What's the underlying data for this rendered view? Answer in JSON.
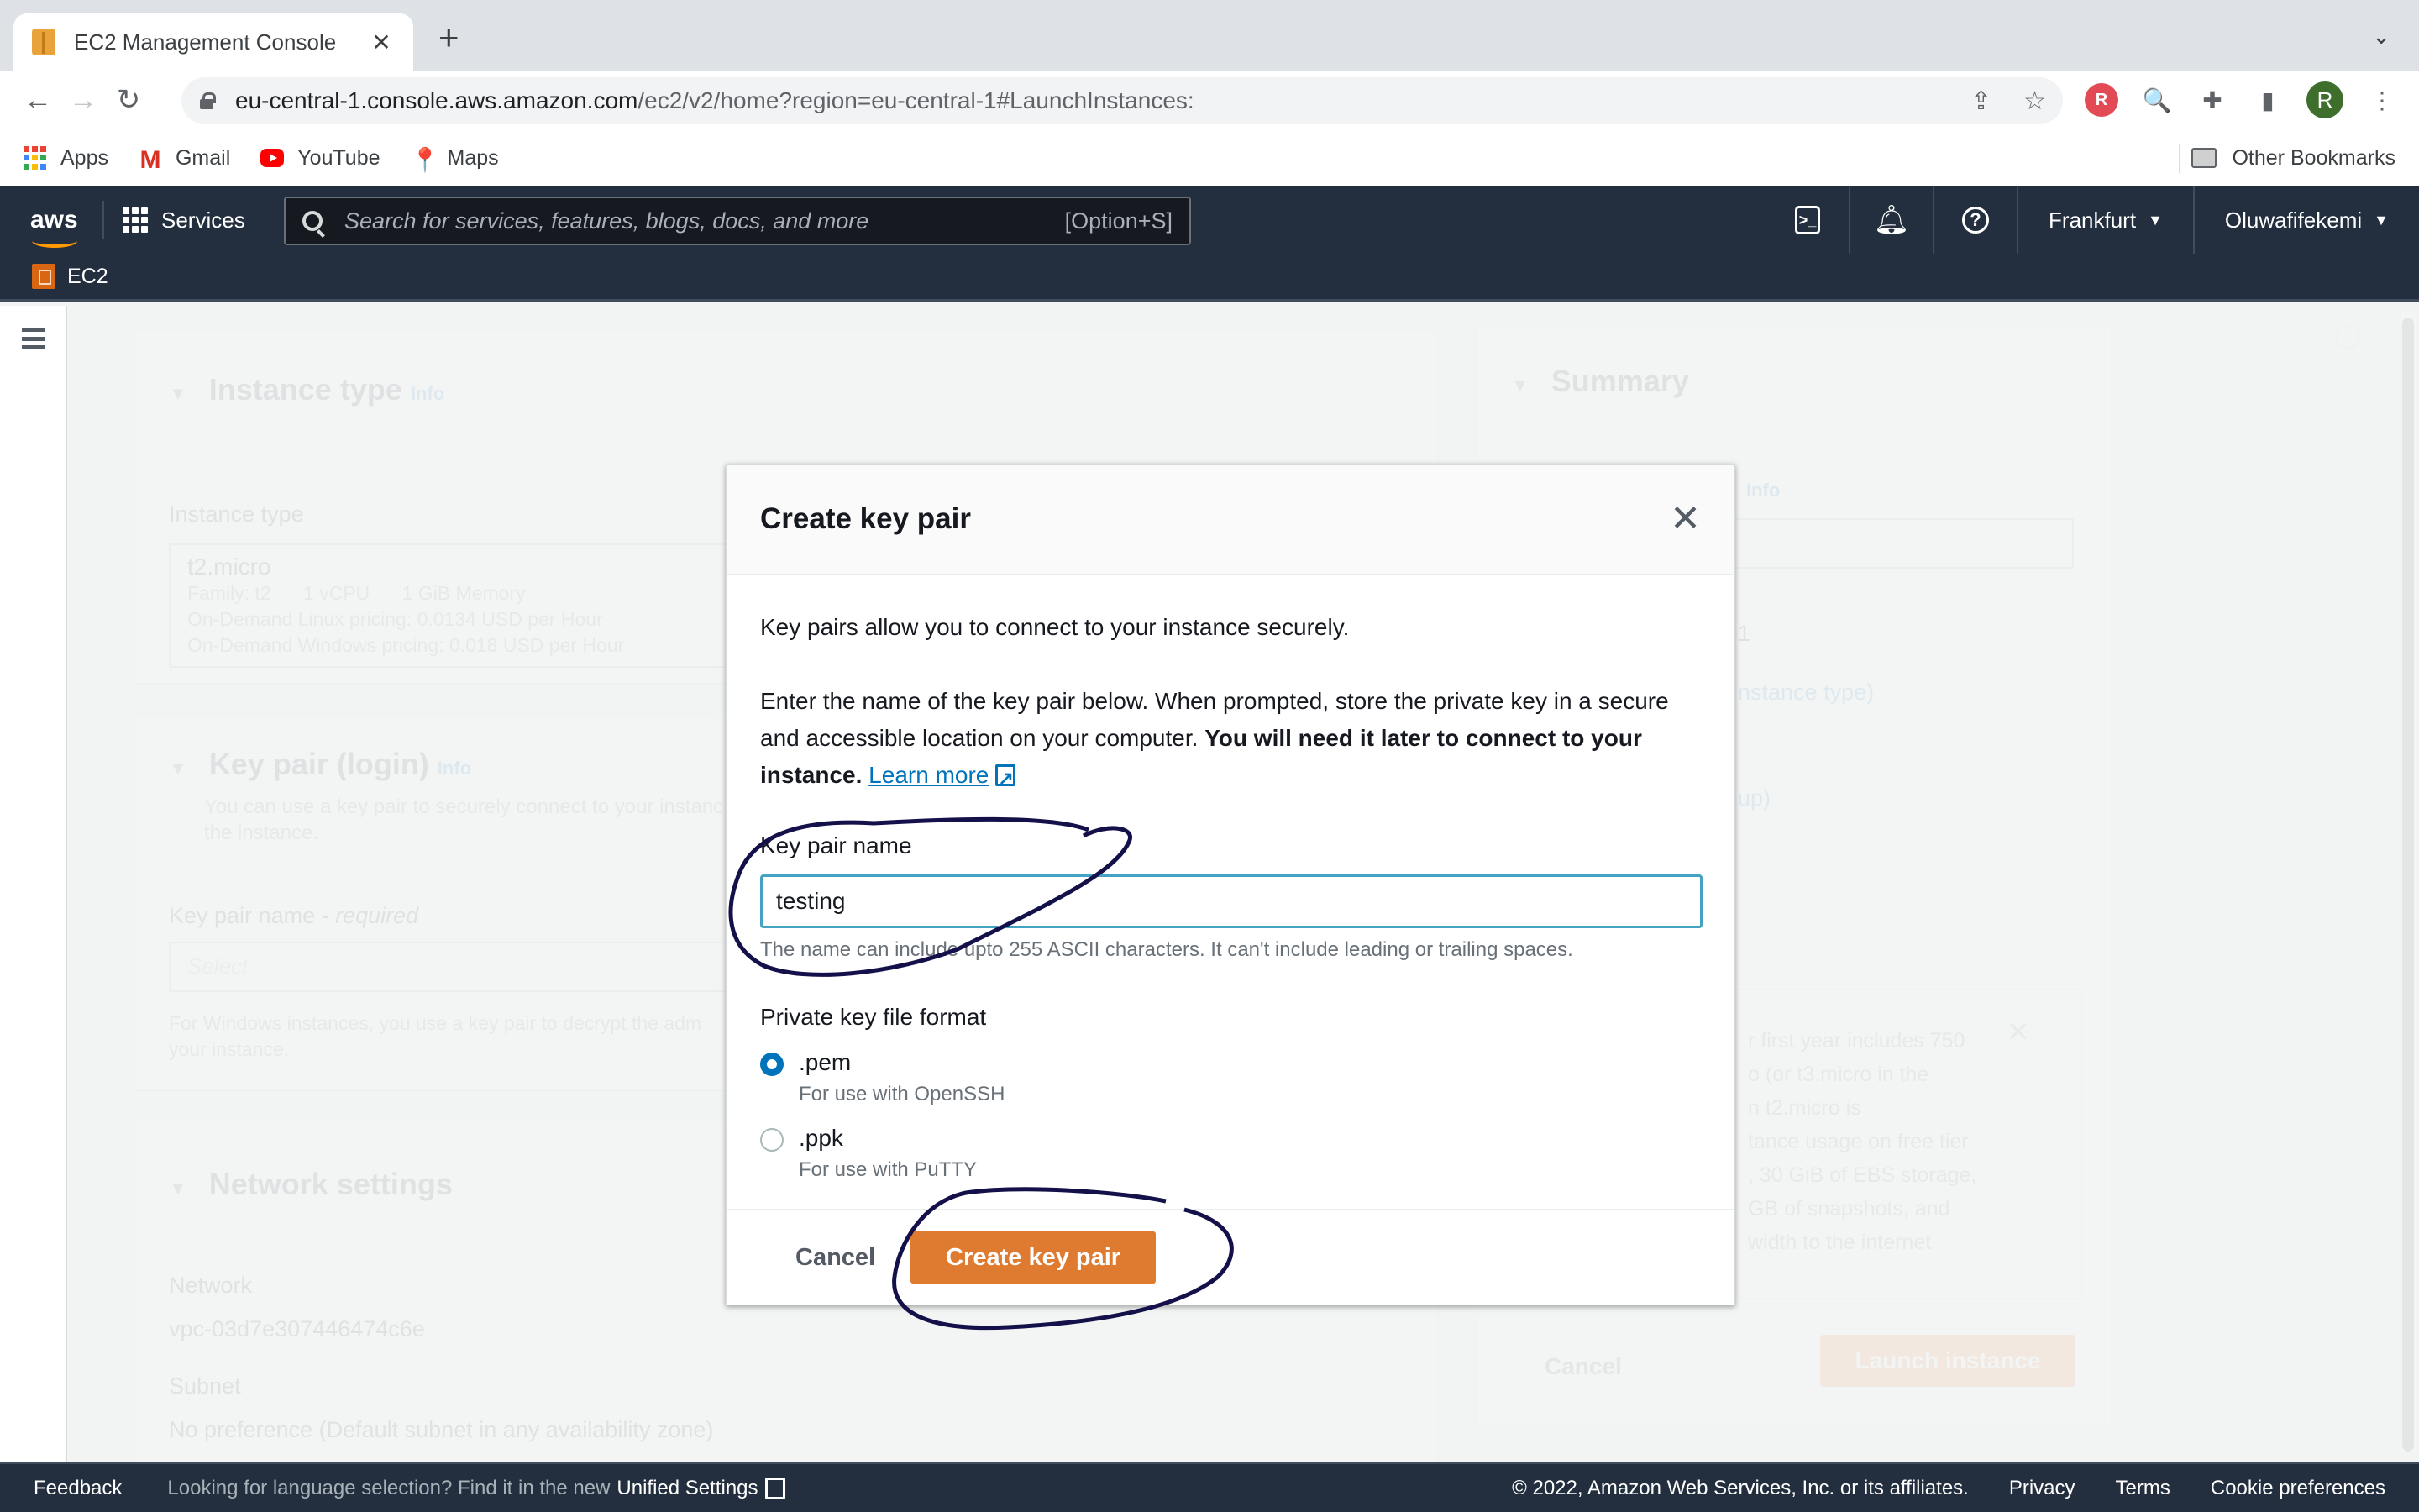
{
  "browser": {
    "tab_title": "EC2 Management Console",
    "tab_close": "✕",
    "new_tab": "+",
    "tab_search": "⌄",
    "url_host": "eu-central-1.console.aws.amazon.com",
    "url_path": "/ec2/v2/home?region=eu-central-1#LaunchInstances:",
    "profile_initial": "R",
    "bookmarks": [
      {
        "label": "Apps",
        "icon": "apps-grid-icon"
      },
      {
        "label": "Gmail",
        "icon": "gmail-icon"
      },
      {
        "label": "YouTube",
        "icon": "youtube-icon"
      },
      {
        "label": "Maps",
        "icon": "maps-pin-icon"
      }
    ],
    "other_bookmarks": "Other Bookmarks",
    "extension_r_label": "R"
  },
  "aws_header": {
    "logo": "aws",
    "services": "Services",
    "search_placeholder": "Search for services, features, blogs, docs, and more",
    "search_shortcut": "[Option+S]",
    "cloudshell_glyph": ">_",
    "help_glyph": "?",
    "region": "Frankfurt",
    "user": "Oluwafifekemi",
    "caret": "▼",
    "service_name": "EC2"
  },
  "background": {
    "instance_type_section": {
      "title": "Instance type",
      "info": "Info",
      "field_label": "Instance type",
      "value": "t2.micro",
      "details": [
        "Family: t2",
        "1 vCPU",
        "1 GiB Memory"
      ],
      "linux_pricing": "On-Demand Linux pricing: 0.0134 USD per Hour",
      "windows_pricing": "On-Demand Windows pricing: 0.018 USD per Hour"
    },
    "key_pair_section": {
      "title": "Key pair (login)",
      "info": "Info",
      "desc_line1": "You can use a key pair to securely connect to your instanc",
      "desc_line2": "the instance.",
      "field_label": "Key pair name - ",
      "field_required": "required",
      "select_placeholder": "Select",
      "help_line1": "For Windows instances, you use a key pair to decrypt the adm",
      "help_line2": "your instance."
    },
    "network_section": {
      "title": "Network settings",
      "network_label": "Network",
      "network_value": "vpc-03d7e307446474c6e",
      "subnet_label": "Subnet",
      "subnet_value": "No preference (Default subnet in any availability zone)"
    },
    "summary": {
      "title": "Summary",
      "info": "Info",
      "frag_1": "1",
      "frag_instance_type": "nstance type)",
      "frag_group": "up)",
      "free_tier_lines": [
        "r first year includes 750",
        "o (or t3.micro in the",
        "n t2.micro is",
        "tance usage on free tier",
        ", 30 GiB of EBS storage,",
        "GB of snapshots, and",
        "width to the internet"
      ],
      "cancel": "Cancel",
      "launch": "Launch instance"
    }
  },
  "modal": {
    "title": "Create key pair",
    "close_glyph": "✕",
    "intro": "Key pairs allow you to connect to your instance securely.",
    "instructions": "Enter the name of the key pair below. When prompted, store the private key in a secure and accessible location on your computer. ",
    "instructions_bold": "You will need it later to connect to your instance.",
    "learn_more": "Learn more",
    "name_label": "Key pair name",
    "name_value": "testing",
    "name_hint": "The name can include upto 255 ASCII characters. It can't include leading or trailing spaces.",
    "format_label": "Private key file format",
    "formats": [
      {
        "label": ".pem",
        "desc": "For use with OpenSSH",
        "selected": true
      },
      {
        "label": ".ppk",
        "desc": "For use with PuTTY",
        "selected": false
      }
    ],
    "cancel": "Cancel",
    "submit": "Create key pair"
  },
  "footer": {
    "feedback": "Feedback",
    "language_msg": "Looking for language selection? Find it in the new",
    "unified_settings": "Unified Settings",
    "copyright": "© 2022, Amazon Web Services, Inc. or its affiliates.",
    "privacy": "Privacy",
    "terms": "Terms",
    "cookies": "Cookie preferences"
  },
  "colors": {
    "aws_nav": "#232f3e",
    "primary_button": "#df7a31",
    "input_focus": "#44a2c4",
    "link": "#0073bb",
    "annotation_ink": "#14104a"
  }
}
